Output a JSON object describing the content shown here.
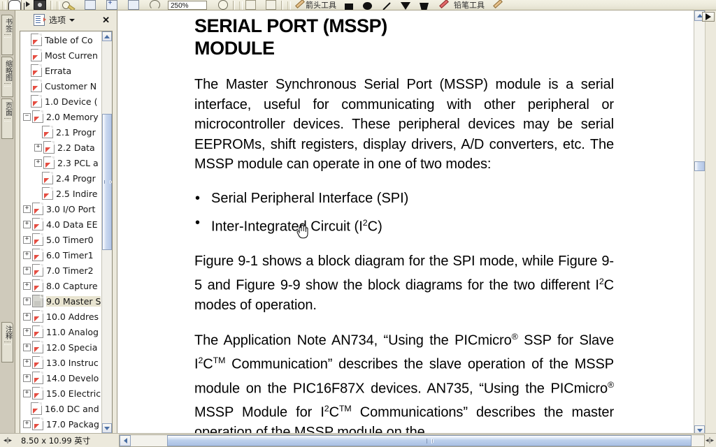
{
  "app": {
    "toolbar": {
      "zoom_value": "250%",
      "arrow_tool_label": "箭头工具",
      "pencil_tool_label": "铅笔工具",
      "icons": [
        "hand-tool-icon",
        "select-tool-icon",
        "snapshot-camera-icon",
        "magnify-tool-icon",
        "page-icon",
        "page-add-icon",
        "page-blank-icon",
        "rotate-circle-icon",
        "zoom-field",
        "circle-icon",
        "previous-page-icon",
        "next-page-icon",
        "line-tool-icon",
        "rectangle-tool-icon",
        "oval-tool-icon",
        "diagonal-line-icon",
        "arrowhead-icon",
        "polygon-tool-icon",
        "red-pencil-icon",
        "tan-pencil-icon"
      ]
    },
    "nav_tabs": [
      {
        "label": "书签",
        "name": "nav-tab-bookmarks"
      },
      {
        "label": "缩略图",
        "name": "nav-tab-thumbnails"
      },
      {
        "label": "页面",
        "name": "nav-tab-pages"
      },
      {
        "label": "注释",
        "name": "nav-tab-comments"
      }
    ],
    "bookmark_panel": {
      "options_label": "选项",
      "close_label": "✕",
      "items": [
        {
          "label": "Table of Co",
          "indent": 0,
          "expander": "none",
          "icon": "pdf-bookmark-icon",
          "selected": false
        },
        {
          "label": "Most Curren",
          "indent": 0,
          "expander": "none",
          "icon": "pdf-bookmark-icon",
          "selected": false
        },
        {
          "label": "Errata",
          "indent": 0,
          "expander": "none",
          "icon": "pdf-bookmark-icon",
          "selected": false
        },
        {
          "label": "Customer N",
          "indent": 0,
          "expander": "none",
          "icon": "pdf-bookmark-icon",
          "selected": false
        },
        {
          "label": "1.0 Device (",
          "indent": 0,
          "expander": "none",
          "icon": "pdf-bookmark-icon",
          "selected": false
        },
        {
          "label": "2.0 Memory",
          "indent": 0,
          "expander": "minus",
          "icon": "pdf-bookmark-icon",
          "selected": false
        },
        {
          "label": "2.1 Progr",
          "indent": 1,
          "expander": "none",
          "icon": "pdf-bookmark-icon",
          "selected": false
        },
        {
          "label": "2.2 Data",
          "indent": 1,
          "expander": "plus",
          "icon": "pdf-bookmark-icon",
          "selected": false
        },
        {
          "label": "2.3 PCL a",
          "indent": 1,
          "expander": "plus",
          "icon": "pdf-bookmark-icon",
          "selected": false
        },
        {
          "label": "2.4 Progr",
          "indent": 1,
          "expander": "none",
          "icon": "pdf-bookmark-icon",
          "selected": false
        },
        {
          "label": "2.5 Indire",
          "indent": 1,
          "expander": "none",
          "icon": "pdf-bookmark-icon",
          "selected": false
        },
        {
          "label": "3.0 I/O Port",
          "indent": 0,
          "expander": "plus",
          "icon": "pdf-bookmark-icon",
          "selected": false
        },
        {
          "label": "4.0 Data EE",
          "indent": 0,
          "expander": "plus",
          "icon": "pdf-bookmark-icon",
          "selected": false
        },
        {
          "label": "5.0 Timer0",
          "indent": 0,
          "expander": "plus",
          "icon": "pdf-bookmark-icon",
          "selected": false
        },
        {
          "label": "6.0 Timer1",
          "indent": 0,
          "expander": "plus",
          "icon": "pdf-bookmark-icon",
          "selected": false
        },
        {
          "label": "7.0 Timer2",
          "indent": 0,
          "expander": "plus",
          "icon": "pdf-bookmark-icon",
          "selected": false
        },
        {
          "label": "8.0 Capture",
          "indent": 0,
          "expander": "plus",
          "icon": "pdf-bookmark-icon",
          "selected": false
        },
        {
          "label": "9.0 Master S",
          "indent": 0,
          "expander": "plus",
          "icon": "pdf-bookmark-icon-grey",
          "selected": true
        },
        {
          "label": "10.0 Addres",
          "indent": 0,
          "expander": "plus",
          "icon": "pdf-bookmark-icon",
          "selected": false
        },
        {
          "label": "11.0 Analog",
          "indent": 0,
          "expander": "plus",
          "icon": "pdf-bookmark-icon",
          "selected": false
        },
        {
          "label": "12.0 Specia",
          "indent": 0,
          "expander": "plus",
          "icon": "pdf-bookmark-icon",
          "selected": false
        },
        {
          "label": "13.0 Instruc",
          "indent": 0,
          "expander": "plus",
          "icon": "pdf-bookmark-icon",
          "selected": false
        },
        {
          "label": "14.0 Develo",
          "indent": 0,
          "expander": "plus",
          "icon": "pdf-bookmark-icon",
          "selected": false
        },
        {
          "label": "15.0 Electric",
          "indent": 0,
          "expander": "plus",
          "icon": "pdf-bookmark-icon",
          "selected": false
        },
        {
          "label": "16.0 DC and",
          "indent": 0,
          "expander": "none",
          "icon": "pdf-bookmark-icon",
          "selected": false
        },
        {
          "label": "17.0 Packag",
          "indent": 0,
          "expander": "plus",
          "icon": "pdf-bookmark-icon",
          "selected": false
        }
      ]
    },
    "status_bar": {
      "page_size": "8.50 x 10.99 英寸"
    }
  },
  "document": {
    "title_line1": "SERIAL PORT (MSSP)",
    "title_line2": "MODULE",
    "paragraph1": "The Master Synchronous Serial Port (MSSP) module is a serial interface, useful for communicating with other peripheral or microcontroller devices. These peripheral devices may be serial EEPROMs, shift registers, display drivers, A/D converters, etc. The MSSP module can operate in one of two modes:",
    "bullet1": "Serial Peripheral Interface (SPI)",
    "bullet2_pre": "Inter-Integrated Circuit (I",
    "bullet2_sup": "2",
    "bullet2_post": "C)",
    "paragraph2_a": "Figure 9-1 shows a block diagram for the SPI mode, while Figure 9-5 and Figure 9-9 show the block diagrams for the two different I",
    "paragraph2_sup": "2",
    "paragraph2_b": "C modes of operation.",
    "paragraph3_a": "The Application Note AN734, “Using the PICmicro",
    "paragraph3_r1": "®",
    "paragraph3_b": " SSP for Slave I",
    "paragraph3_sup1": "2",
    "paragraph3_c": "C",
    "paragraph3_tm1": "TM",
    "paragraph3_d": " Communication” describes the slave operation of the MSSP module on the PIC16F87X devices. AN735, “Using the PICmicro",
    "paragraph3_r2": "®",
    "paragraph3_e": " MSSP Module for I",
    "paragraph3_sup2": "2",
    "paragraph3_f": "C",
    "paragraph3_tm2": "TM",
    "paragraph3_g": " Communications” describes",
    "paragraph4_clipped": "the master operation of the MSSP module on the"
  }
}
